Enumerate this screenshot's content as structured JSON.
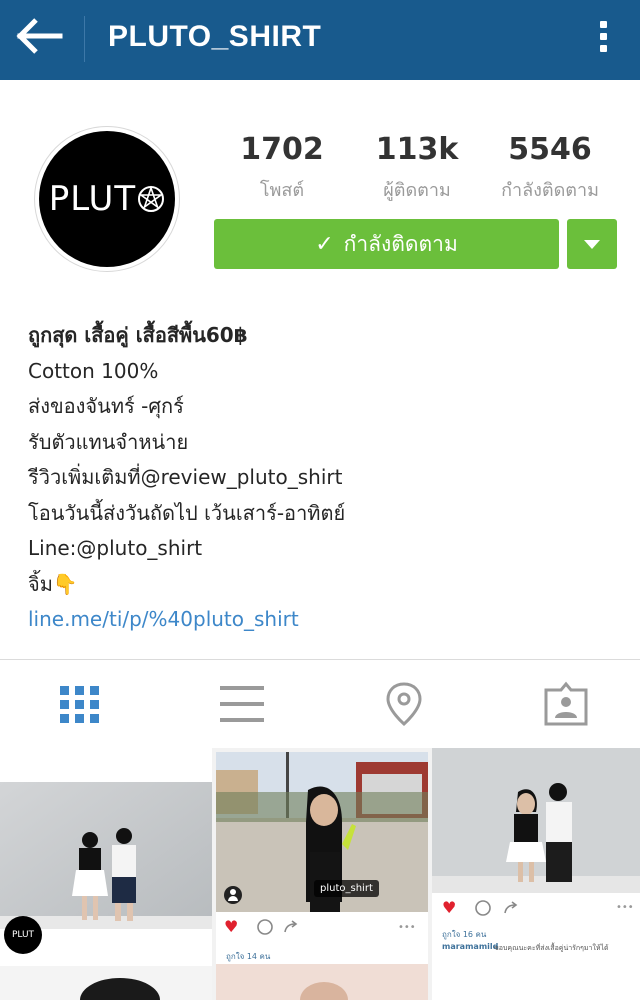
{
  "header": {
    "title": "PLUTO_SHIRT"
  },
  "profile": {
    "avatar_text": "PLUT",
    "stats": [
      {
        "value": "1702",
        "label": "โพสต์"
      },
      {
        "value": "113k",
        "label": "ผู้ติดตาม"
      },
      {
        "value": "5546",
        "label": "กำลังติดตาม"
      }
    ],
    "follow_label": "กำลังติดตาม"
  },
  "bio": {
    "name": "ถูกสุด เสื้อคู่ เสื้อสีพื้น60฿",
    "lines": [
      "Cotton 100%",
      "ส่งของจันทร์ -ศุกร์",
      "รับตัวแทนจำหน่าย",
      "รีวิวเพิ่มเติมที่@review_pluto_shirt",
      "โอนวันนี้ส่งวันถัดไป เว้นเสาร์-อาทิตย์",
      "Line:@pluto_shirt",
      "จิ้ม👇"
    ],
    "link": "line.me/ti/p/%40pluto_shirt"
  },
  "tabs": [
    {
      "icon": "grid-icon",
      "active": true
    },
    {
      "icon": "list-icon",
      "active": false
    },
    {
      "icon": "location-pin-icon",
      "active": false
    },
    {
      "icon": "tagged-photos-icon",
      "active": false
    }
  ],
  "posts": [
    {
      "avatar_text": "PLUT"
    },
    {
      "tag_text": "pluto_shirt",
      "likes": "ถูกใจ 14 คน"
    },
    {
      "likes": "ถูกใจ 16 คน",
      "comment_user": "maramamild",
      "comment_text": "ขอบคุณนะคะที่ส่งเสื้อคู่น่ารักๆมาให้ได้"
    }
  ],
  "colors": {
    "header_bg": "#185a8d",
    "follow_green": "#6bbf3b",
    "link_blue": "#3d87c9",
    "active_tab_blue": "#3d87c9",
    "heart_red": "#e0212e"
  }
}
